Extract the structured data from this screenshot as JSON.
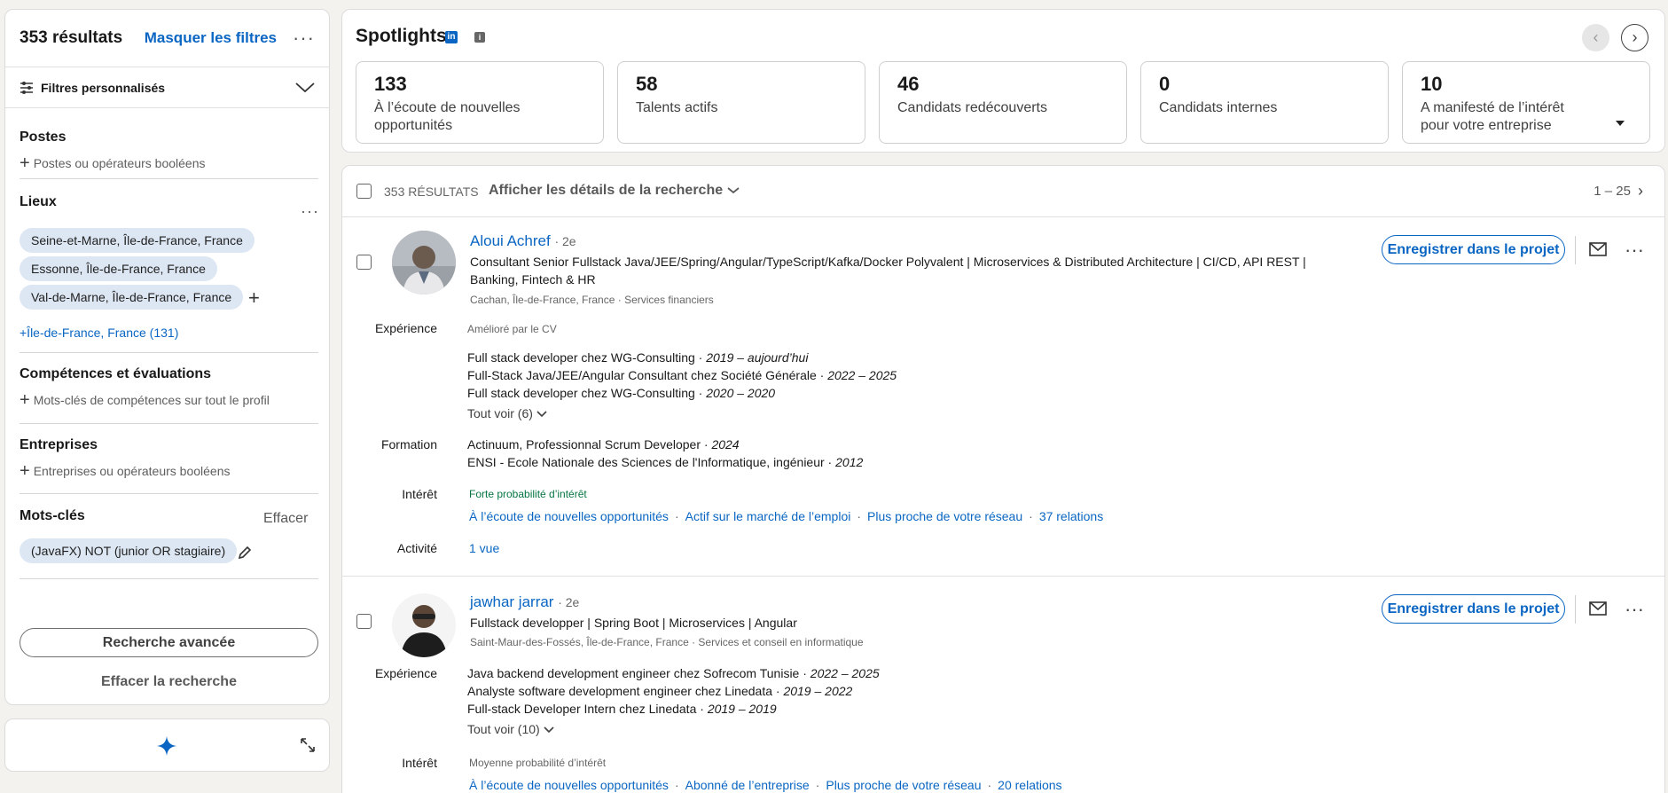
{
  "filters": {
    "results_count": "353 résultats",
    "hide_filters": "Masquer les filtres",
    "custom_filters": "Filtres personnalisés",
    "postes": {
      "title": "Postes",
      "add": "Postes ou opérateurs booléens"
    },
    "lieux": {
      "title": "Lieux",
      "pills": [
        "Seine-et-Marne, Île-de-France, France",
        "Essonne, Île-de-France, France",
        "Val-de-Marne, Île-de-France, France"
      ],
      "more_link": "+Île-de-France, France (131)"
    },
    "competences": {
      "title": "Compétences et évaluations",
      "add": "Mots-clés de compétences sur tout le profil"
    },
    "entreprises": {
      "title": "Entreprises",
      "add": "Entreprises ou opérateurs booléens"
    },
    "motscles": {
      "title": "Mots-clés",
      "clear": "Effacer",
      "pill": "(JavaFX) NOT (junior OR stagiaire)"
    },
    "advanced_search": "Recherche avancée",
    "clear_search": "Effacer la recherche"
  },
  "spotlights": {
    "title": "Spotlights",
    "stats": [
      {
        "number": "133",
        "label": "À l’écoute de nouvelles opportunités"
      },
      {
        "number": "58",
        "label": "Talents actifs"
      },
      {
        "number": "46",
        "label": "Candidats redécouverts"
      },
      {
        "number": "0",
        "label": "Candidats internes"
      },
      {
        "number": "10",
        "label": "A manifesté de l’intérêt pour votre entreprise"
      }
    ]
  },
  "results": {
    "count_label": "353 RÉSULTATS",
    "details": "Afficher les détails de la recherche",
    "pagination": "1 – 25",
    "save_label": "Enregistrer dans le projet",
    "labels": {
      "experience": "Expérience",
      "formation": "Formation",
      "interet": "Intérêt",
      "activite": "Activité"
    },
    "candidates": [
      {
        "name": "Aloui Achref",
        "degree": "· 2e",
        "headline": "Consultant Senior Fullstack Java/JEE/Spring/Angular/TypeScript/Kafka/Docker Polyvalent | Microservices & Distributed Architecture | CI/CD, API REST | Banking, Fintech & HR",
        "location": "Cachan, Île-de-France, France · Services financiers",
        "experience_note": "Amélioré par le CV",
        "experience": [
          {
            "text": "Full stack developer chez WG-Consulting · ",
            "dates": "2019 – aujourd’hui"
          },
          {
            "text": "Full-Stack Java/JEE/Angular Consultant chez Société Générale · ",
            "dates": "2022 – 2025"
          },
          {
            "text": "Full stack developer chez WG-Consulting · ",
            "dates": "2020 – 2020"
          }
        ],
        "see_all": "Tout voir (6)",
        "formation": [
          {
            "text": "Actinuum, Professionnal Scrum Developer · ",
            "dates": "2024"
          },
          {
            "text": "ENSI - Ecole Nationale des Sciences de l'Informatique, ingénieur · ",
            "dates": "2012"
          }
        ],
        "interest_level": "Forte probabilité d’intérêt",
        "signals": [
          "À l’écoute de nouvelles opportunités",
          "Actif sur le marché de l’emploi",
          "Plus proche de votre réseau",
          "37 relations"
        ],
        "activity": "1 vue"
      },
      {
        "name": "jawhar jarrar",
        "degree": "· 2e",
        "headline": "Fullstack developper | Spring Boot | Microservices | Angular",
        "location": "Saint-Maur-des-Fossés, Île-de-France, France · Services et conseil en informatique",
        "experience": [
          {
            "text": "Java backend development engineer chez Sofrecom Tunisie · ",
            "dates": "2022 – 2025"
          },
          {
            "text": "Analyste software development engineer chez Linedata · ",
            "dates": "2019 – 2022"
          },
          {
            "text": "Full-stack Developer Intern chez Linedata · ",
            "dates": "2019 – 2019"
          }
        ],
        "see_all": "Tout voir (10)",
        "interest_level": "Moyenne probabilité d’intérêt",
        "signals": [
          "À l’écoute de nouvelles opportunités",
          "Abonné de l’entreprise",
          "Plus proche de votre réseau",
          "20 relations"
        ]
      }
    ]
  }
}
